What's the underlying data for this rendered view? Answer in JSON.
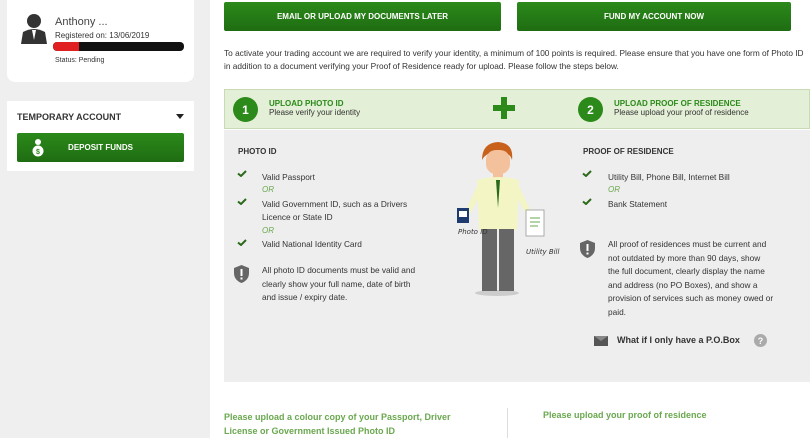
{
  "profile": {
    "name": "Anthony ...",
    "registered": "Registered on: 13/06/2019",
    "status": "Status: Pending",
    "progress_fraction": 0.2
  },
  "sidebar": {
    "temp_title": "TEMPORARY ACCOUNT",
    "deposit_label": "DEPOSIT FUNDS"
  },
  "actions": {
    "later_label": "EMAIL OR UPLOAD MY DOCUMENTS LATER",
    "fund_label": "FUND MY ACCOUNT NOW"
  },
  "intro": "To activate your trading account we are required to verify your identity, a minimum of 100 points is required. Please ensure that you have one form of Photo ID in addition to a document verifying your Proof of Residence ready for upload. Please follow the steps below.",
  "steps": [
    {
      "number": "1",
      "title": "UPLOAD PHOTO ID",
      "subtitle": "Please verify your identity"
    },
    {
      "number": "2",
      "title": "UPLOAD PROOF OF RESIDENCE",
      "subtitle": "Please upload your proof of residence"
    }
  ],
  "photo_id": {
    "heading": "PHOTO ID",
    "items": [
      "Valid Passport",
      "Valid Government ID, such as a Drivers",
      "Licence or State ID",
      "Valid National Identity Card"
    ],
    "or": "OR",
    "note": [
      "All photo ID documents must be valid and",
      "clearly show your full name, date of birth",
      "and issue / expiry date."
    ]
  },
  "proof": {
    "heading": "PROOF OF RESIDENCE",
    "items": [
      "Utility Bill, Phone Bill, Internet Bill",
      "Bank Statement"
    ],
    "or": "OR",
    "note": [
      "All proof of residences must be current and",
      "not outdated by more than 90 days, show",
      "the full document, clearly display the name",
      "and address (no PO Boxes), and show a",
      "provision of services such as money owed or",
      "paid."
    ],
    "pobox": "What if I only have a P.O.Box",
    "help": "?"
  },
  "illustration": {
    "photo_label": "Photo ID",
    "bill_label": "Utility Bill"
  },
  "upload": {
    "left": "Please upload a colour copy of your Passport, Driver License or Government Issued Photo ID",
    "right": "Please upload your proof of residence"
  },
  "colors": {
    "accent": "#2b8a1a",
    "light_green": "#6aa84f",
    "step_bg": "#e3efd6"
  }
}
